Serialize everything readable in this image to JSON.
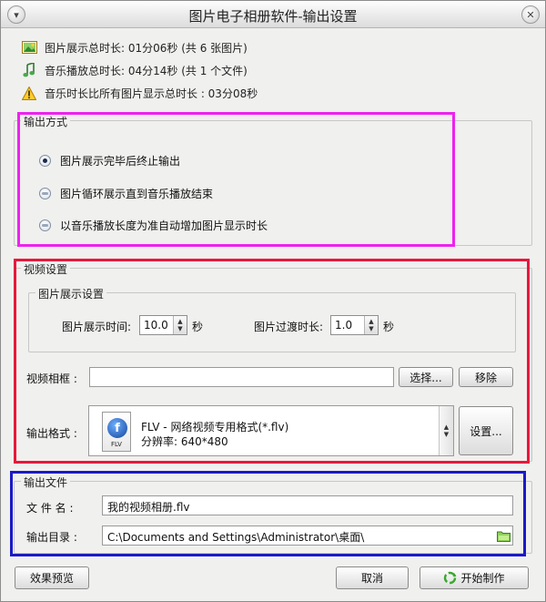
{
  "window": {
    "title": "图片电子相册软件-输出设置",
    "minimize_glyph": "▾",
    "close_glyph": "✕"
  },
  "info": {
    "image_total": "图片展示总时长: 01分06秒 (共 6 张图片)",
    "music_total": "音乐播放总时长: 04分14秒 (共 1 个文件)",
    "warning": "音乐时长比所有图片显示总时长 : 03分08秒"
  },
  "output_mode": {
    "legend": "输出方式",
    "options": [
      {
        "label": "图片展示完毕后终止输出",
        "selected": true
      },
      {
        "label": "图片循环展示直到音乐播放结束",
        "selected": false
      },
      {
        "label": "以音乐播放长度为准自动增加图片显示时长",
        "selected": false
      }
    ]
  },
  "video": {
    "legend": "视频设置",
    "image_group_legend": "图片展示设置",
    "display_time_label": "图片展示时间:",
    "display_time_value": "10.0",
    "display_time_unit": "秒",
    "transition_label": "图片过渡时长:",
    "transition_value": "1.0",
    "transition_unit": "秒",
    "frame_label": "视频相框 :",
    "frame_value": "",
    "select_btn": "选择...",
    "remove_btn": "移除",
    "format_label": "输出格式 :",
    "format_name": "FLV - 网络视频专用格式(*.flv)",
    "format_resolution": "分辨率: 640*480",
    "format_icon_ext": "FLV",
    "settings_btn": "设置..."
  },
  "output_file": {
    "legend": "输出文件",
    "filename_label": "文 件 名 :",
    "filename_value": "我的视频相册.flv",
    "dir_label": "输出目录 :",
    "dir_value": "C:\\Documents and Settings\\Administrator\\桌面\\"
  },
  "footer": {
    "preview_btn": "效果预览",
    "cancel_btn": "取消",
    "start_btn": "开始制作"
  },
  "colors": {
    "highlight_output_mode": "#ee22ee",
    "highlight_video": "#e8183c",
    "highlight_output_file": "#1a1ac8"
  }
}
